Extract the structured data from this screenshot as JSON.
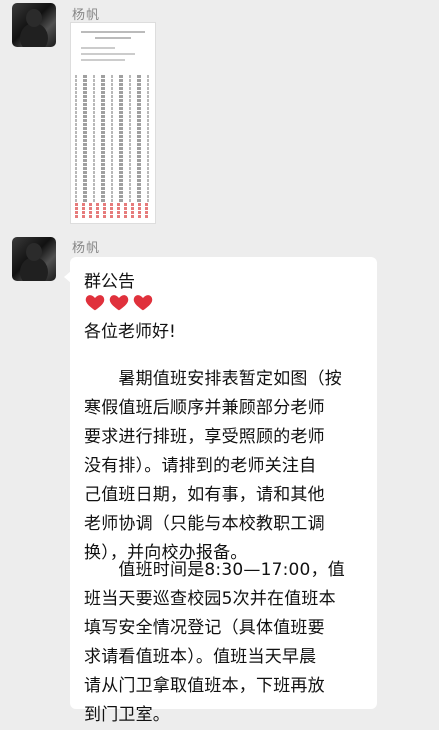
{
  "messages": [
    {
      "sender": "杨帆",
      "type": "image"
    },
    {
      "sender": "杨帆",
      "type": "text",
      "title": "群公告",
      "hearts": 3,
      "greeting": "各位老师好!",
      "paragraph1": [
        "　　暑期值班安排表暂定如图（按",
        "寒假值班后顺序并兼顾部分老师",
        "要求进行排班，享受照顾的老师",
        "没有排）。请排到的老师关注自",
        "己值班日期，如有事，请和其他",
        "老师协调（只能与本校教职工调",
        "换），并向校办报备。"
      ],
      "paragraph2": [
        "　　值班时间是8:30—17:00，值",
        "班当天要巡查校园5次并在值班本",
        "填写安全情况登记（具体值班要",
        "求请看值班本）。值班当天早晨",
        "请从门卫拿取值班本，下班再放",
        "到门卫室。"
      ]
    }
  ],
  "colors": {
    "heart": "#e0313c",
    "background": "#ededed",
    "bubble": "#ffffff"
  }
}
